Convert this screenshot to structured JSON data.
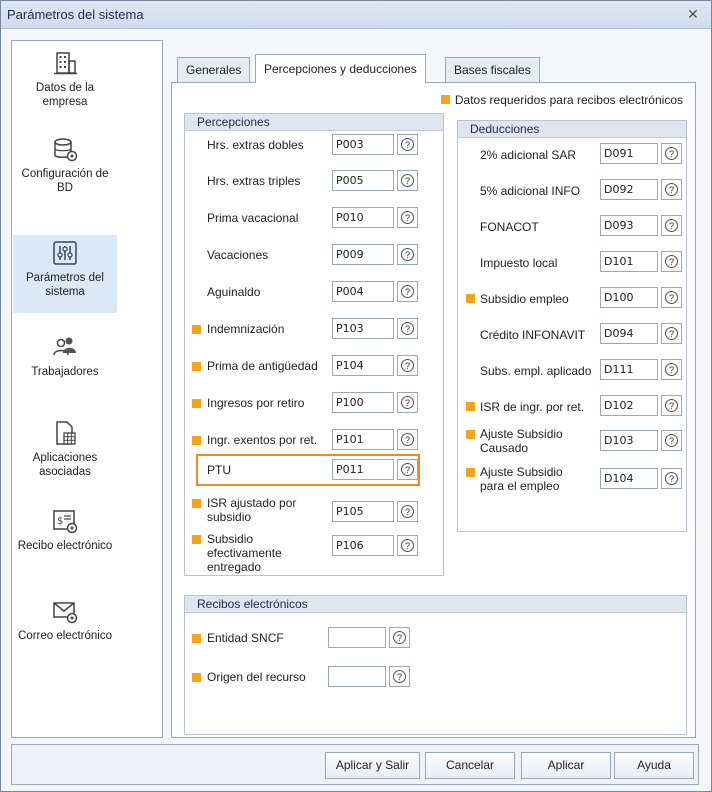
{
  "window": {
    "title": "Parámetros del sistema",
    "close_glyph": "✕"
  },
  "sidebar": {
    "items": [
      {
        "label": "Datos de la empresa",
        "icon": "building-icon"
      },
      {
        "label": "Configuración de BD",
        "icon": "database-gear-icon"
      },
      {
        "label": "Parámetros del sistema",
        "icon": "sliders-icon",
        "active": true
      },
      {
        "label": "Trabajadores",
        "icon": "people-icon"
      },
      {
        "label": "Aplicaciones asociadas",
        "icon": "document-grid-icon"
      },
      {
        "label": "Recibo electrónico",
        "icon": "receipt-gear-icon"
      },
      {
        "label": "Correo electrónico",
        "icon": "envelope-gear-icon"
      }
    ]
  },
  "tabs": [
    {
      "label": "Generales"
    },
    {
      "label": "Percepciones y deducciones",
      "active": true
    },
    {
      "label": "Bases fiscales"
    }
  ],
  "legend": "Datos requeridos para recibos electrónicos",
  "percepciones": {
    "title": "Percepciones",
    "rows": [
      {
        "label": "Hrs. extras dobles",
        "value": "P003",
        "required": false
      },
      {
        "label": "Hrs. extras triples",
        "value": "P005",
        "required": false
      },
      {
        "label": "Prima vacacional",
        "value": "P010",
        "required": false
      },
      {
        "label": "Vacaciones",
        "value": "P009",
        "required": false
      },
      {
        "label": "Aguinaldo",
        "value": "P004",
        "required": false
      },
      {
        "label": "Indemnización",
        "value": "P103",
        "required": true
      },
      {
        "label": "Prima de antigüedad",
        "value": "P104",
        "required": true
      },
      {
        "label": "Ingresos por retiro",
        "value": "P100",
        "required": true
      },
      {
        "label": "Ingr. exentos por ret.",
        "value": "P101",
        "required": true
      },
      {
        "label": "PTU",
        "value": "P011",
        "required": false,
        "highlighted": true
      },
      {
        "label": "ISR ajustado por subsidio",
        "value": "P105",
        "required": true
      },
      {
        "label": "Subsidio efectivamente entregado",
        "value": "P106",
        "required": true
      }
    ]
  },
  "deducciones": {
    "title": "Deducciones",
    "rows": [
      {
        "label": "2% adicional SAR",
        "value": "D091",
        "required": false
      },
      {
        "label": "5% adicional INFO",
        "value": "D092",
        "required": false
      },
      {
        "label": "FONACOT",
        "value": "D093",
        "required": false
      },
      {
        "label": "Impuesto local",
        "value": "D101",
        "required": false
      },
      {
        "label": "Subsidio empleo",
        "value": "D100",
        "required": true
      },
      {
        "label": "Crédito INFONAVIT",
        "value": "D094",
        "required": false
      },
      {
        "label": "Subs. empl. aplicado",
        "value": "D111",
        "required": false
      },
      {
        "label": "ISR de ingr. por ret.",
        "value": "D102",
        "required": true
      },
      {
        "label": "Ajuste Subsidio Causado",
        "value": "D103",
        "required": true
      },
      {
        "label": "Ajuste Subsidio para el empleo",
        "value": "D104",
        "required": true
      }
    ]
  },
  "recibos": {
    "title": "Recibos electrónicos",
    "rows": [
      {
        "label": "Entidad SNCF",
        "value": "",
        "required": true
      },
      {
        "label": "Origen del recurso",
        "value": "",
        "required": true
      }
    ]
  },
  "help_glyph": "?",
  "buttons": {
    "apply_exit": "Aplicar y Salir",
    "cancel": "Cancelar",
    "apply": "Aplicar",
    "help": "Ayuda"
  },
  "colors": {
    "required_marker": "#f5a31a",
    "highlight": "#f0891e",
    "active_item": "#dbe8f6"
  }
}
